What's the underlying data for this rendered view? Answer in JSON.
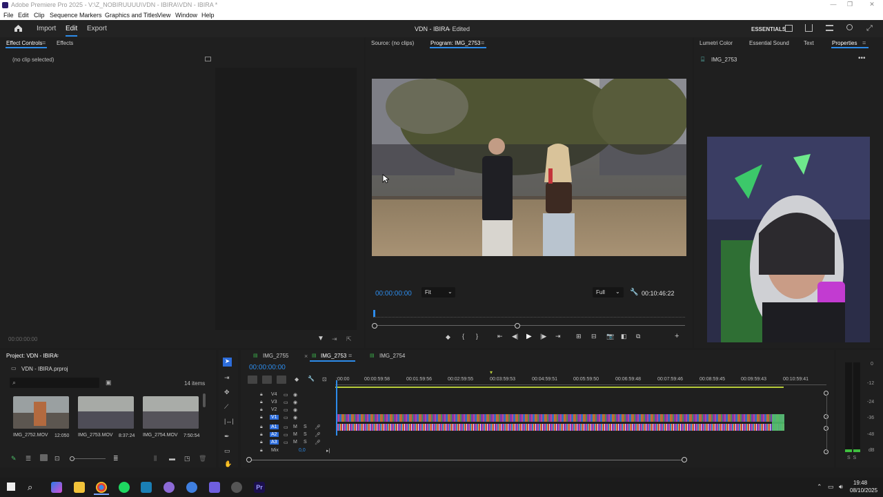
{
  "window": {
    "title": "Adobe Premiere Pro 2025 - V:\\Z_NOBIRUUUU\\VDN - IBIRA\\VDN - IBIRA *",
    "min": "—",
    "max": "❐",
    "close": "✕"
  },
  "menu": [
    "File",
    "Edit",
    "Clip",
    "Sequence",
    "Markers",
    "Graphics and Titles",
    "View",
    "Window",
    "Help"
  ],
  "topnav": {
    "import": "Import",
    "edit": "Edit",
    "export": "Export",
    "doc_title": "VDN - IBIRA",
    "doc_status": "- Edited",
    "workspace": "ESSENTIALS"
  },
  "effect_controls": {
    "tab1": "Effect Controls",
    "tab2": "Effects",
    "no_clip": "(no clip selected)",
    "timecode": "00:00:00:00"
  },
  "source": {
    "tab": "Source: (no clips)",
    "program_tab": "Program: IMG_2753"
  },
  "program": {
    "timecode": "00:00:00:00",
    "zoom": "Fit",
    "quality": "Full",
    "duration": "00:10:46:22"
  },
  "right": {
    "tabs": [
      "Lumetri Color",
      "Essential Sound",
      "Text",
      "Properties"
    ],
    "clip_name": "IMG_2753"
  },
  "project": {
    "title": "Project: VDN - IBIRA",
    "file": "VDN - IBIRA.prproj",
    "items": "14 items",
    "clips": [
      {
        "name": "IMG_2752.MOV",
        "dur": "12:050"
      },
      {
        "name": "IMG_2753.MOV",
        "dur": "8:37:24"
      },
      {
        "name": "IMG_2754.MOV",
        "dur": "7:50:54"
      }
    ]
  },
  "timeline": {
    "tabs": [
      "IMG_2755",
      "IMG_2753",
      "IMG_2754"
    ],
    "timecode": "00:00:00:00",
    "ruler": [
      ":00:00",
      "00:00:59:58",
      "00:01:59:56",
      "00:02:59:55",
      "00:03:59:53",
      "00:04:59:51",
      "00:05:59:50",
      "00:06:59:48",
      "00:07:59:46",
      "00:08:59:45",
      "00:09:59:43",
      "00:10:59:41"
    ],
    "video_tracks": [
      "V4",
      "V3",
      "V2",
      "V1"
    ],
    "audio_tracks": [
      "A1",
      "A2",
      "A3"
    ],
    "mix_label": "Mix",
    "mix_value": "0,0",
    "meter_labels": [
      "0",
      "-12",
      "-24",
      "-36",
      "-48",
      "dB"
    ],
    "meter_ss": "S  S"
  },
  "clock": {
    "time": "19:48",
    "date": "08/10/2025"
  },
  "colors": {
    "accent": "#2d8ceb",
    "timecode": "#2d8ceb",
    "panel": "#1f1f1f"
  }
}
